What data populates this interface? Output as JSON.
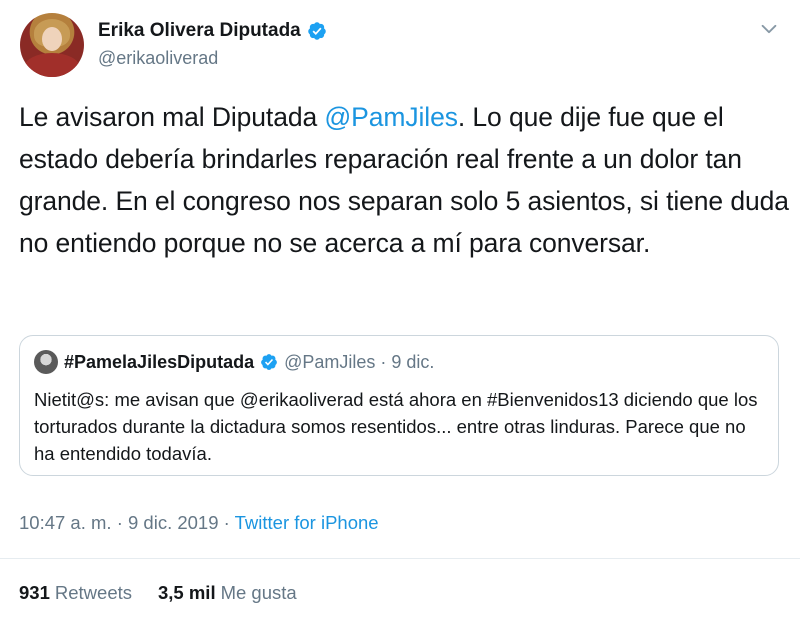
{
  "author": {
    "name": "Erika Olivera Diputada",
    "handle": "@erikaoliverad",
    "verified": true
  },
  "tweet": {
    "text_before": "Le avisaron mal Diputada ",
    "mention": "@PamJiles",
    "text_after": ". Lo que dije fue que el estado debería brindarles reparación real frente a un dolor tan grande. En el congreso nos separan solo 5 asientos, si tiene duda no entiendo porque no se acerca a mí para conversar."
  },
  "quote": {
    "name": "#PamelaJilesDiputada",
    "handle_date": "@PamJiles · 9 dic.",
    "text": "Nietit@s: me avisan que @erikaoliverad está ahora en #Bienvenidos13 diciendo que los torturados durante la dictadura somos resentidos... entre otras linduras. Parece que no ha entendido todavía."
  },
  "meta": {
    "timestamp": "10:47 a. m. · 9 dic. 2019 · ",
    "source": "Twitter for iPhone"
  },
  "stats": {
    "retweets_count": "931",
    "retweets_label": "Retweets",
    "likes_count": "3,5 mil",
    "likes_label": "Me gusta"
  },
  "colors": {
    "link": "#1b95e0",
    "secondary": "#657786",
    "verified": "#1da1f2"
  }
}
